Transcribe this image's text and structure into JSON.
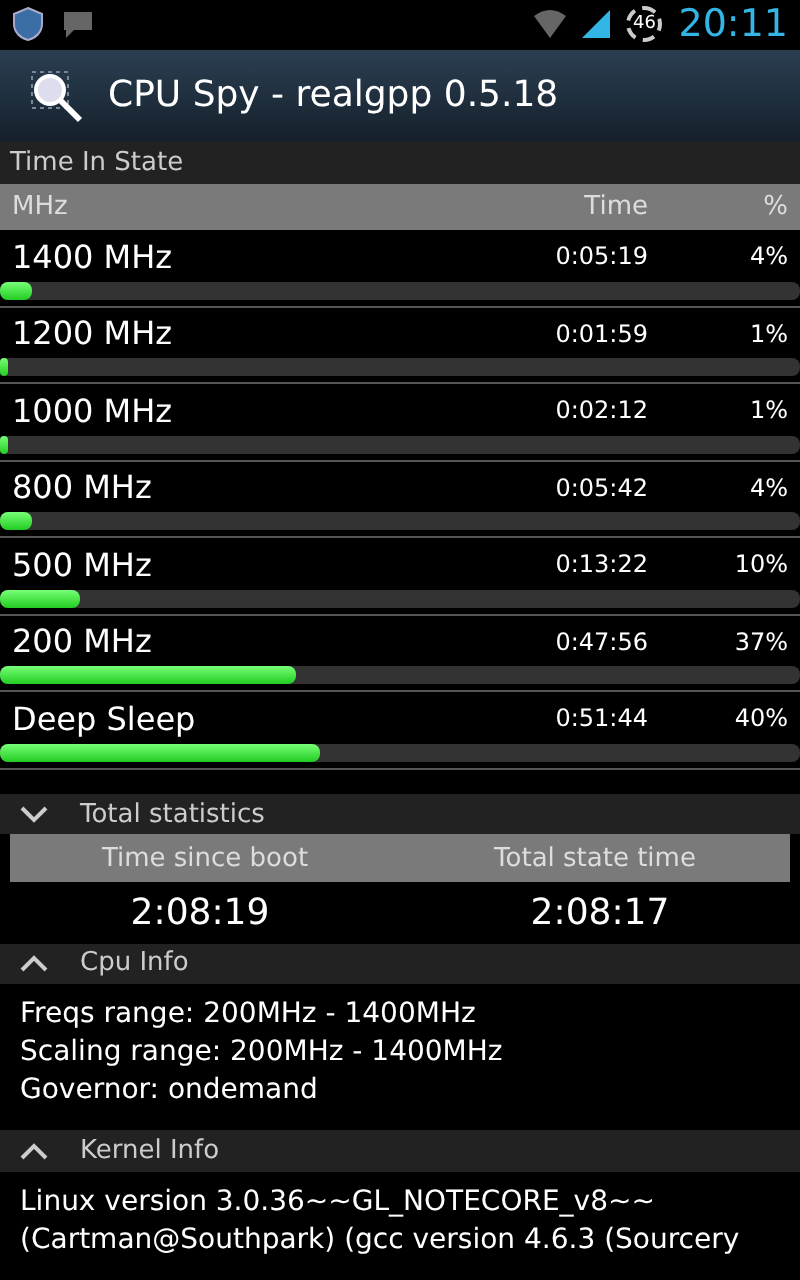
{
  "status_bar": {
    "battery_text": "46",
    "time": "20:11"
  },
  "action_bar": {
    "title": "CPU Spy - realgpp 0.5.18"
  },
  "time_in_state": {
    "title": "Time In State",
    "columns": [
      "MHz",
      "Time",
      "%"
    ],
    "rows": [
      {
        "name": "1400 MHz",
        "time": "0:05:19",
        "percent": "4%",
        "level": 0.04
      },
      {
        "name": "1200 MHz",
        "time": "0:01:59",
        "percent": "1%",
        "level": 0.01
      },
      {
        "name": "1000 MHz",
        "time": "0:02:12",
        "percent": "1%",
        "level": 0.01
      },
      {
        "name": "800 MHz",
        "time": "0:05:42",
        "percent": "4%",
        "level": 0.04
      },
      {
        "name": "500 MHz",
        "time": "0:13:22",
        "percent": "10%",
        "level": 0.1
      },
      {
        "name": "200 MHz",
        "time": "0:47:56",
        "percent": "37%",
        "level": 0.37
      },
      {
        "name": "Deep Sleep",
        "time": "0:51:44",
        "percent": "40%",
        "level": 0.4
      }
    ]
  },
  "total_statistics": {
    "title": "Total statistics",
    "expanded": false,
    "columns": [
      "Time since boot",
      "Total state time"
    ],
    "values": [
      "2:08:19",
      "2:08:17"
    ]
  },
  "cpu_info": {
    "title": "Cpu Info",
    "expanded": true,
    "lines": [
      "Freqs range: 200MHz - 1400MHz",
      "Scaling range: 200MHz - 1400MHz",
      "Governor: ondemand"
    ]
  },
  "kernel_info": {
    "title": "Kernel Info",
    "expanded": true,
    "lines": [
      "Linux version 3.0.36~~GL_NOTECORE_v8~~",
      "(Cartman@Southpark) (gcc version 4.6.3 (Sourcery"
    ]
  }
}
